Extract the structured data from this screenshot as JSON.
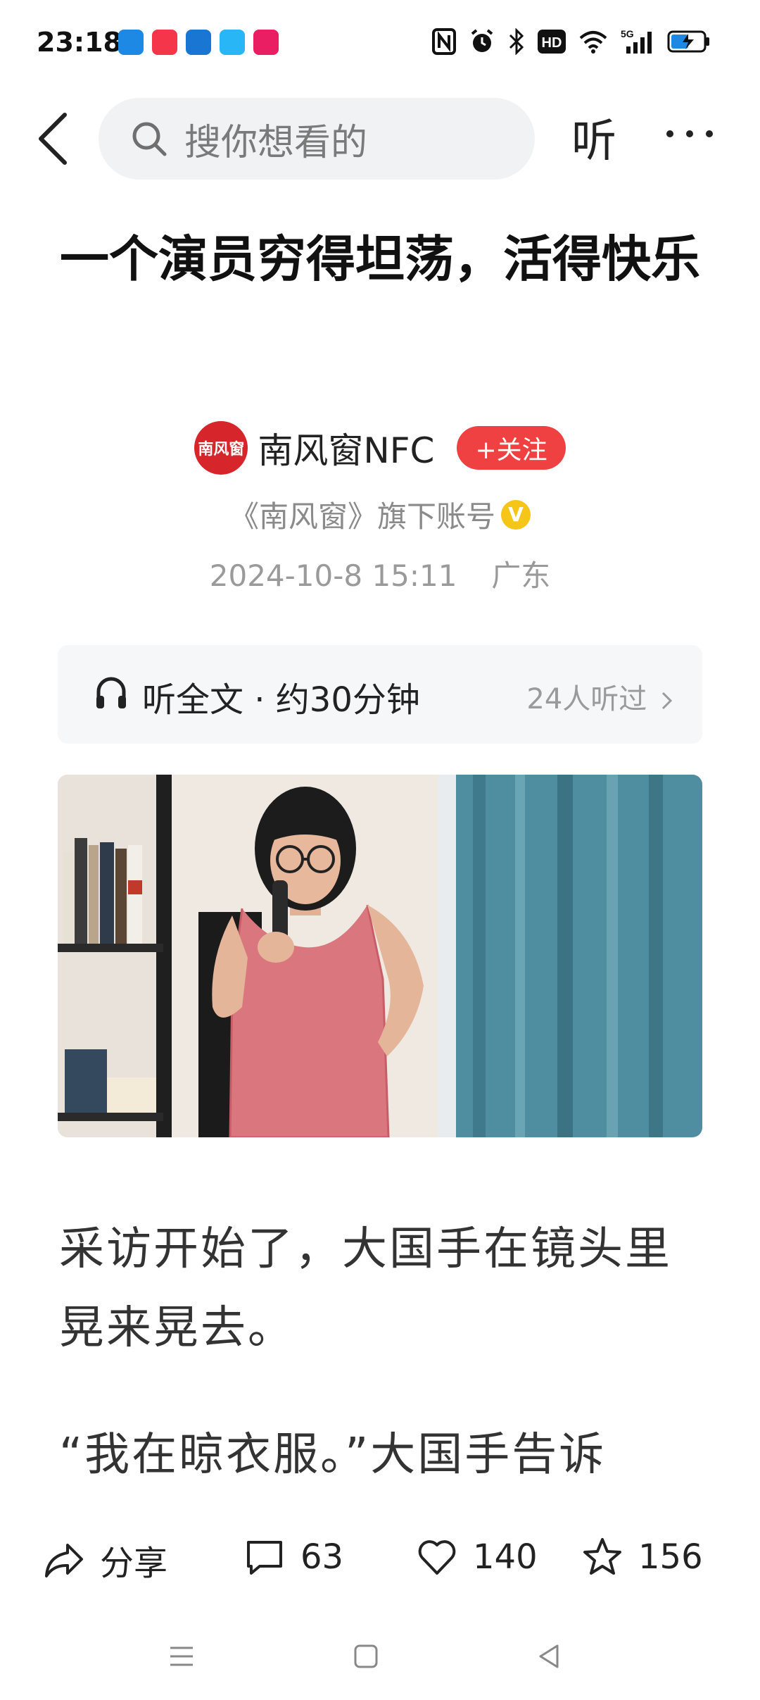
{
  "status_bar": {
    "time": "23:18",
    "app_icons": [
      {
        "name": "shield-app-icon",
        "color": "#1e88e5"
      },
      {
        "name": "xiaohongshu-app-icon",
        "color": "#f5364a"
      },
      {
        "name": "navigation-app-icon",
        "color": "#1976d2"
      },
      {
        "name": "browser-app-icon",
        "color": "#29b6f6"
      },
      {
        "name": "shopping-app-icon",
        "color": "#e91e63"
      }
    ],
    "network": "5G",
    "hd_label": "HD"
  },
  "header": {
    "search_placeholder": "搜你想看的",
    "listen_label": "听"
  },
  "article": {
    "title": "一个演员穷得坦荡，活得快乐",
    "author": {
      "name": "南风窗NFC",
      "avatar_text": "南风窗",
      "follow_label": "+关注",
      "description": "《南风窗》旗下账号",
      "verify_mark": "V"
    },
    "date": "2024-10-8  15:11",
    "location": "广东",
    "listen_card": {
      "label": "听全文 · 约30分钟",
      "count": "24人听过"
    },
    "paragraphs": [
      "采访开始了，大国手在镜头里晃来晃去。",
      "“我在晾衣服。”大国手告诉"
    ]
  },
  "actions": {
    "share_label": "分享",
    "comments": "63",
    "likes": "140",
    "favorites": "156"
  },
  "colors": {
    "accent": "#f04142",
    "brand": "#d7252c",
    "verify": "#f5c518",
    "muted": "#9a9a9a"
  }
}
